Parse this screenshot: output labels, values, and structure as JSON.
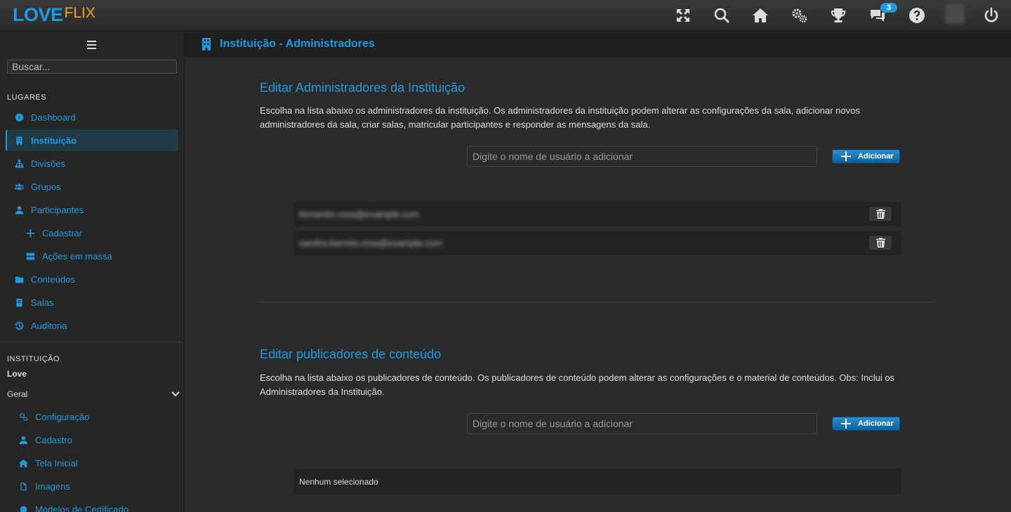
{
  "app": {
    "logo_love": "LOVE",
    "logo_flix": "FLIX",
    "notifications_count": "3",
    "accent_color": "#1e9be0",
    "icons": [
      "expand-icon",
      "search-icon",
      "home-icon",
      "settings-icon",
      "trophy-icon",
      "chat-icon",
      "help-icon",
      "avatar",
      "power-icon"
    ]
  },
  "sidebar": {
    "search_placeholder": "Buscar...",
    "places_title": "LUGARES",
    "items": [
      {
        "label": "Dashboard",
        "icon": "dashboard-icon"
      },
      {
        "label": "Instituição",
        "icon": "building-icon",
        "active": true
      },
      {
        "label": "Divisões",
        "icon": "sitemap-icon"
      },
      {
        "label": "Grupos",
        "icon": "users-icon"
      },
      {
        "label": "Participantes",
        "icon": "user-icon"
      },
      {
        "label": "Cadastrar",
        "icon": "plus-icon"
      },
      {
        "label": "Ações em massa",
        "icon": "server-icon"
      },
      {
        "label": "Conteúdos",
        "icon": "folder-icon"
      },
      {
        "label": "Salas",
        "icon": "book-icon"
      },
      {
        "label": "Auditoria",
        "icon": "history-icon"
      }
    ],
    "institution_title": "INSTITUIÇÃO",
    "institution_name": "Love",
    "geral_label": "Geral",
    "geral_items": [
      {
        "label": "Configuração",
        "icon": "cogs-icon"
      },
      {
        "label": "Cadastro",
        "icon": "user-icon"
      },
      {
        "label": "Tela Inicial",
        "icon": "home-icon"
      },
      {
        "label": "Imagens",
        "icon": "file-icon"
      },
      {
        "label": "Modelos de Certificado",
        "icon": "certificate-icon"
      }
    ]
  },
  "page": {
    "title": "Instituição - Administradores"
  },
  "admins": {
    "heading": "Editar Administradores da Instituição",
    "description": "Escolha na lista abaixo os administradores da instituição. Os administradores da instituição podem alterar as configurações da sala, adicionar novos administradores da sala, criar salas, matricular participantes e responder as mensagens da sala.",
    "input_placeholder": "Digite o nome de usuário a adicionar",
    "add_label": "Adicionar",
    "rows": [
      "fernando.rosa@example.com",
      "sandra.barreto.rosa@example.com"
    ]
  },
  "publishers": {
    "heading": "Editar publicadores de conteúdo",
    "description": "Escolha na lista abaixo os publicadores de conteúdo. Os publicadores de conteúdo podem alterar as configurações e o material de conteúdos. Obs: Inclui os Administradores da Instituição.",
    "input_placeholder": "Digite o nome de usuário a adicionar",
    "add_label": "Adicionar",
    "empty_label": "Nenhum selecionado"
  }
}
